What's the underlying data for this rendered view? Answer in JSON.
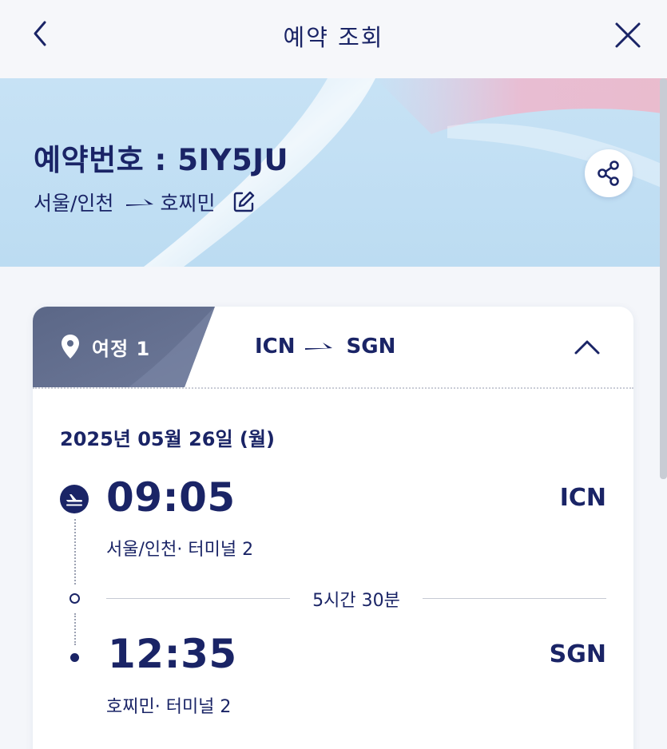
{
  "nav": {
    "title": "예약 조회"
  },
  "booking": {
    "number_label": "예약번호 : 5IY5JU",
    "origin": "서울/인천",
    "destination": "호찌민"
  },
  "itinerary": {
    "tab_label": "여정 1",
    "from_code": "ICN",
    "to_code": "SGN",
    "date": "2025년 05월 26일 (월)",
    "departure": {
      "time": "09:05",
      "code": "ICN",
      "place": "서울/인천· 터미널  2"
    },
    "duration": "5시간 30분",
    "arrival": {
      "time": "12:35",
      "code": "SGN",
      "place": "호찌민· 터미널  2"
    }
  },
  "icons": {
    "back": "chevron-left-icon",
    "close": "close-icon",
    "share": "share-icon",
    "edit": "edit-icon",
    "pin": "location-pin-icon",
    "collapse": "chevron-up-icon",
    "departure": "plane-takeoff-icon"
  },
  "colors": {
    "primary": "#1a2466",
    "tab_bg": "#5d6a8a",
    "hero_bg": "#c3e0f4",
    "page_bg": "#f4f6fa"
  }
}
